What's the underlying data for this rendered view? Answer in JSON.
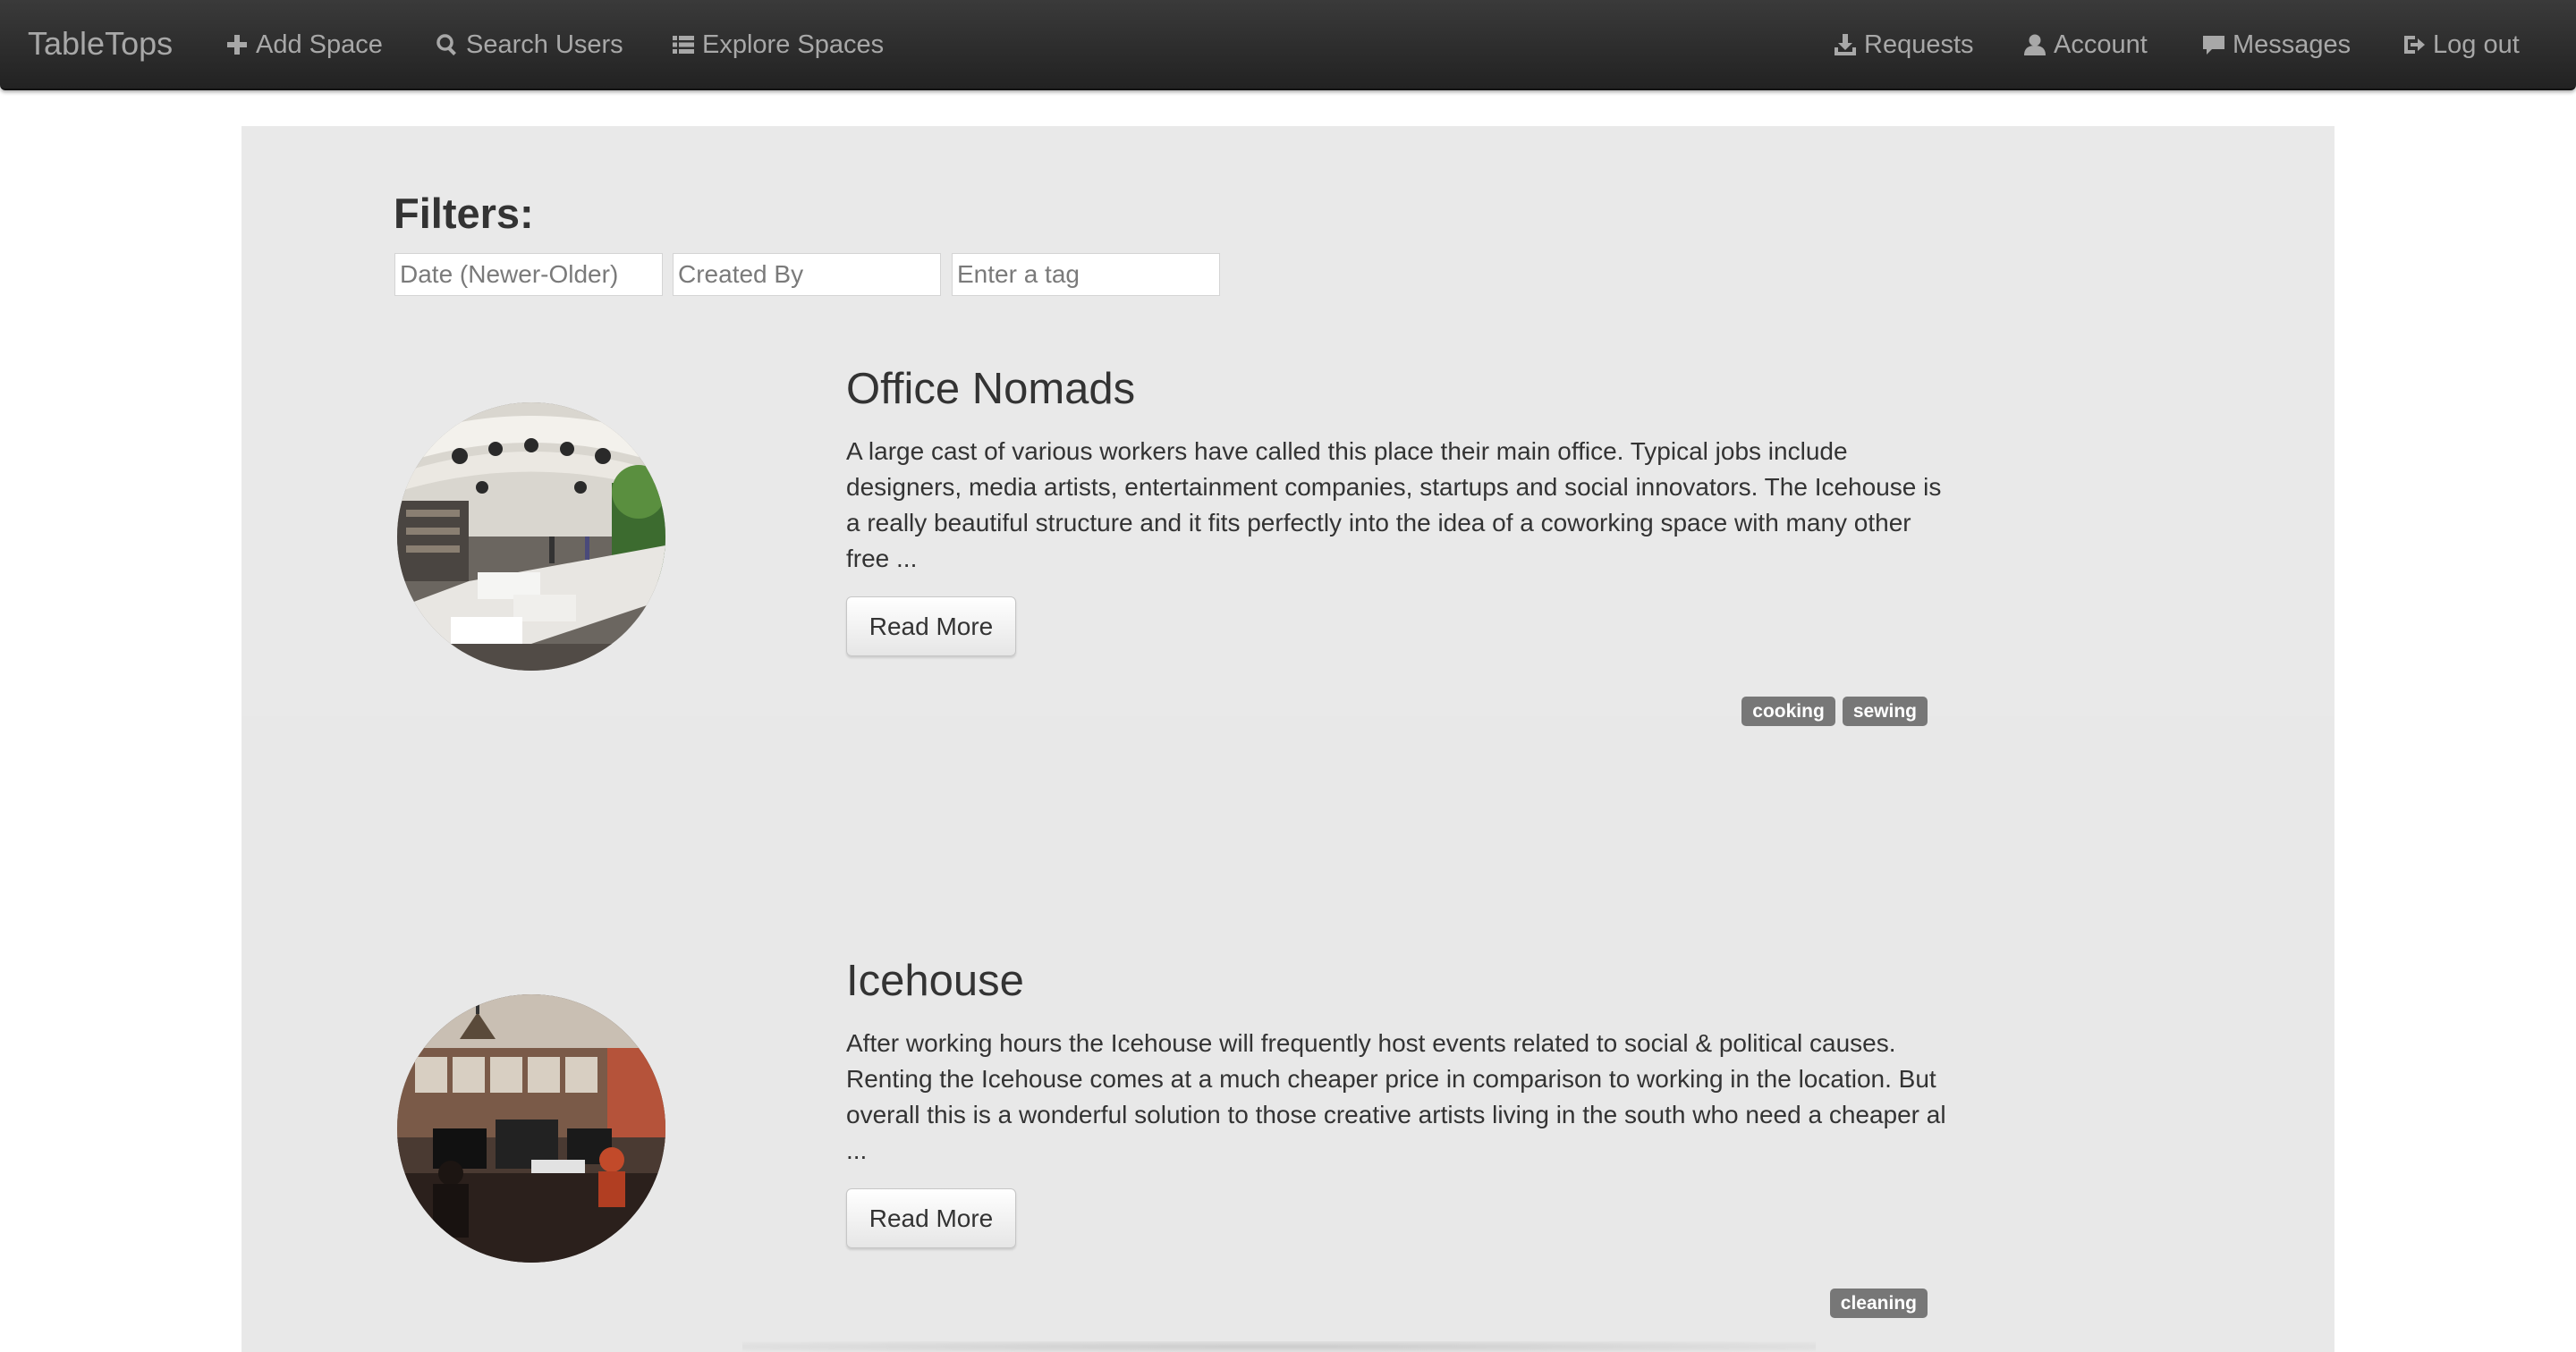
{
  "navbar": {
    "brand": "TableTops",
    "left_items": [
      {
        "label": "Add Space",
        "icon": "plus-icon"
      },
      {
        "label": "Search Users",
        "icon": "search-icon"
      },
      {
        "label": "Explore Spaces",
        "icon": "list-icon"
      }
    ],
    "right_items": [
      {
        "label": "Requests",
        "icon": "download-icon"
      },
      {
        "label": "Account",
        "icon": "user-icon"
      },
      {
        "label": "Messages",
        "icon": "comment-icon"
      },
      {
        "label": "Log out",
        "icon": "logout-icon"
      }
    ]
  },
  "filters": {
    "title": "Filters:",
    "date_placeholder": "Date (Newer-Older)",
    "created_by_placeholder": "Created By",
    "tag_placeholder": "Enter a tag"
  },
  "spaces": [
    {
      "title": "Office Nomads",
      "description": "A large cast of various workers have called this place their main office. Typical jobs include designers, media artists, entertainment companies, startups and social innovators. The Icehouse is a really beautiful structure and it fits perfectly into the idea of a coworking space with many other free ...",
      "button_label": "Read More",
      "tags": [
        "cooking",
        "sewing"
      ]
    },
    {
      "title": "Icehouse",
      "description": "After working hours the Icehouse will frequently host events related to social & political causes. Renting the Icehouse comes at a much cheaper price in comparison to working in the location. But overall this is a wonderful solution to those creative artists living in the south who need a cheaper al ...",
      "button_label": "Read More",
      "tags": [
        "cleaning"
      ]
    }
  ],
  "colors": {
    "navbar_bg": "#2b2b2b",
    "nav_text": "#a8a8a8",
    "panel_bg": "#e8e8e8",
    "tag_bg": "#777777"
  }
}
